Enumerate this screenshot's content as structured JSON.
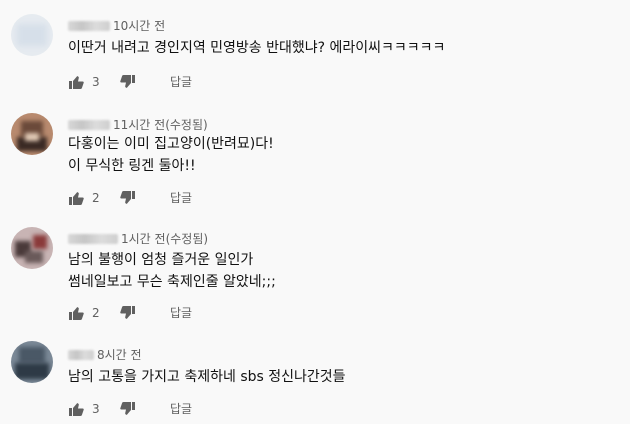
{
  "comments": [
    {
      "time": "10시간 전",
      "lines": [
        "이딴거 내려고 경인지역 민영방송 반대했냐? 에라이씨ㅋㅋㅋㅋㅋ"
      ],
      "likes": "3",
      "reply_label": "답글",
      "avatar_colors": [
        "#dfe6ee",
        "#cfd9e4",
        "#e6ebf0"
      ]
    },
    {
      "time": "11시간 전(수정됨)",
      "lines": [
        "다홍이는 이미 집고양이(반려묘)다!",
        "이 무식한 링겐 둘아!!"
      ],
      "likes": "2",
      "reply_label": "답글",
      "avatar_colors": [
        "#6b4a3a",
        "#b88a6e",
        "#3a2a24"
      ]
    },
    {
      "time": "1시간 전(수정됨)",
      "lines": [
        "남의 불행이 엄청 즐거운 일인가",
        "썸네일보고 무슨 축제인줄 알았네;;;"
      ],
      "likes": "2",
      "reply_label": "답글",
      "avatar_colors": [
        "#4a3a3a",
        "#c8b4b4",
        "#8a3a3a"
      ]
    },
    {
      "time": "8시간 전",
      "lines": [
        "남의 고통을 가지고 축제하네 sbs 정신나간것들"
      ],
      "likes": "3",
      "reply_label": "답글",
      "avatar_colors": [
        "#4a5866",
        "#7a8896",
        "#2e3a46"
      ]
    }
  ]
}
